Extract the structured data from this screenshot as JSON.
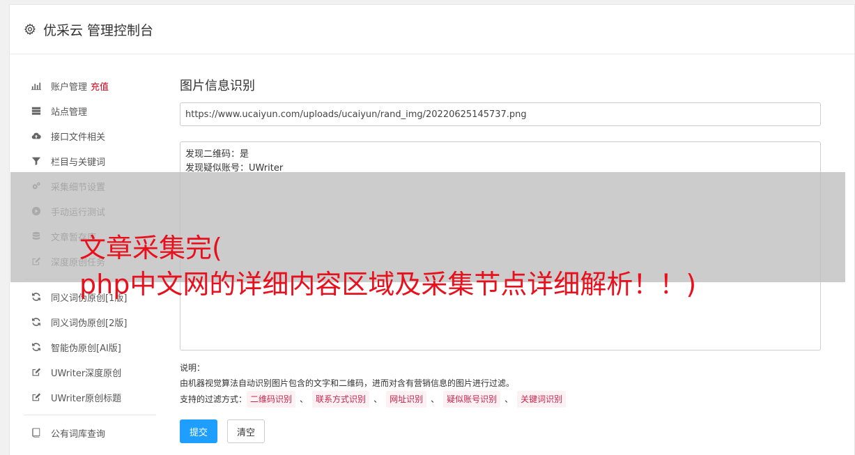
{
  "header": {
    "title": "优采云 管理控制台"
  },
  "sidebar": {
    "groups": [
      [
        {
          "label": "账户管理",
          "icon": "bar-chart-icon",
          "badge": "充值"
        },
        {
          "label": "站点管理",
          "icon": "server-icon"
        },
        {
          "label": "接口文件相关",
          "icon": "cloud-upload-icon"
        },
        {
          "label": "栏目与关键词",
          "icon": "filter-icon"
        },
        {
          "label": "采集细节设置",
          "icon": "gears-icon"
        },
        {
          "label": "手动运行测试",
          "icon": "play-icon"
        },
        {
          "label": "文章暂存库",
          "icon": "database-icon"
        },
        {
          "label": "深度原创任务",
          "icon": "edit-icon"
        }
      ],
      [
        {
          "label": "同义词伪原创[1版]",
          "icon": "refresh-icon"
        },
        {
          "label": "同义词伪原创[2版]",
          "icon": "refresh-icon"
        },
        {
          "label": "智能伪原创[AI版]",
          "icon": "refresh-icon"
        },
        {
          "label": "UWriter深度原创",
          "icon": "edit-icon"
        },
        {
          "label": "UWriter原创标题",
          "icon": "edit-icon"
        }
      ],
      [
        {
          "label": "公有词库查询",
          "icon": "book-icon"
        }
      ]
    ]
  },
  "main": {
    "section_title": "图片信息识别",
    "url_value": "https://www.ucaiyun.com/uploads/ucaiyun/rand_img/20220625145737.png",
    "result_lines": [
      "发现二维码：是",
      "发现疑似账号：UWriter"
    ],
    "desc_label": "说明：",
    "desc_text": "由机器视觉算法自动识别图片包含的文字和二维码，进而对含有营销信息的图片进行过滤。",
    "filter_label": "支持的过滤方式：",
    "filter_tags": [
      "二维码识别",
      "联系方式识别",
      "网址识别",
      "疑似账号识别",
      "关键词识别"
    ],
    "filter_separator": "、",
    "submit_label": "提交",
    "clear_label": "清空"
  },
  "overlay": {
    "line1": "文章采集完(",
    "line2": "php中文网的详细内容区域及采集节点详细解析！！)"
  },
  "colors": {
    "accent": "#1e9fff",
    "recharge": "#d9001b",
    "overlay_text": "#e8101c",
    "tag_text": "#c7254e"
  }
}
